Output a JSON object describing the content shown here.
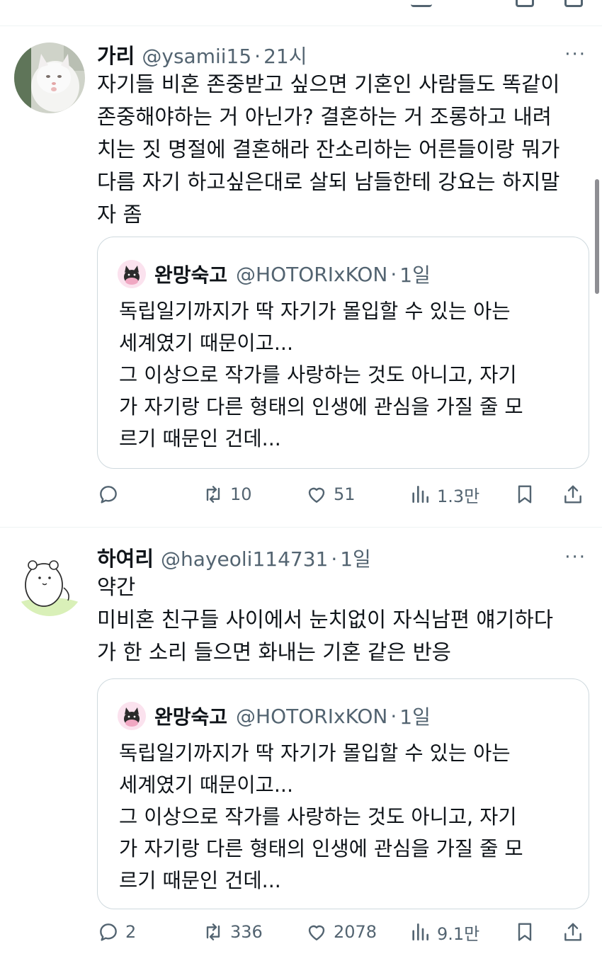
{
  "tweets": [
    {
      "name": "가리",
      "handle": "@ysamii15",
      "dot": "·",
      "time": "21시",
      "more": "···",
      "text_lines": [
        "자기들 비혼 존중받고 싶으면 기혼인 사람들도 똑같이",
        "존중해야하는 거 아닌가? 결혼하는 거 조롱하고 내려",
        "치는 짓 명절에 결혼해라 잔소리하는 어른들이랑 뭐가",
        "다름 자기 하고싶은대로 살되 남들한테 강요는 하지말",
        "자 좀"
      ],
      "quote": {
        "name": "완망숙고",
        "handle": "@HOTORIxKON",
        "dot": "·",
        "time": "1일",
        "text_lines": [
          "독립일기까지가 딱 자기가 몰입할 수 있는 아는",
          "세계였기 때문이고...",
          "그 이상으로 작가를 사랑하는 것도 아니고, 자기",
          "가 자기랑 다른 형태의 인생에 관심을 가질 줄 모",
          "르기 때문인 건데..."
        ]
      },
      "actions": {
        "replies": "",
        "retweets": "10",
        "likes": "51",
        "views": "1.3만"
      }
    },
    {
      "name": "하여리",
      "handle": "@hayeoli114731",
      "dot": "·",
      "time": "1일",
      "more": "···",
      "text_lines": [
        "약간",
        "미비혼 친구들 사이에서 눈치없이 자식남편 얘기하다",
        "가 한 소리 들으면 화내는 기혼 같은 반응"
      ],
      "quote": {
        "name": "완망숙고",
        "handle": "@HOTORIxKON",
        "dot": "·",
        "time": "1일",
        "text_lines": [
          "독립일기까지가 딱 자기가 몰입할 수 있는 아는",
          "세계였기 때문이고...",
          "그 이상으로 작가를 사랑하는 것도 아니고, 자기",
          "가 자기랑 다른 형태의 인생에 관심을 가질 줄 모",
          "르기 때문인 건데..."
        ]
      },
      "actions": {
        "replies": "2",
        "retweets": "336",
        "likes": "2078",
        "views": "9.1만"
      }
    }
  ],
  "icons": [
    "reply-icon",
    "retweet-icon",
    "like-icon",
    "views-icon",
    "bookmark-icon",
    "share-icon",
    "more-icon"
  ],
  "colors": {
    "text": "#0f1419",
    "secondary": "#536471",
    "border": "#cfd9de",
    "divider": "#eff3f4"
  }
}
